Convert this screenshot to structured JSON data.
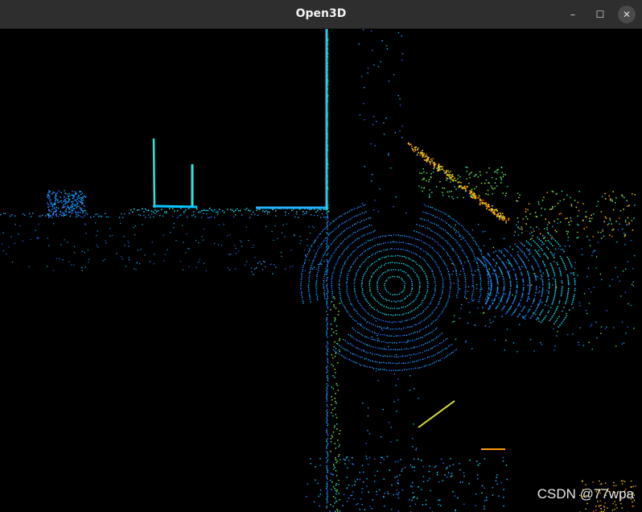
{
  "window": {
    "title": "Open3D"
  },
  "controls": {
    "minimize": "–",
    "maximize": "☐",
    "close": "✕"
  },
  "viewport": {
    "background": "#000000"
  },
  "watermark": {
    "text": "CSDN @77wpa"
  }
}
